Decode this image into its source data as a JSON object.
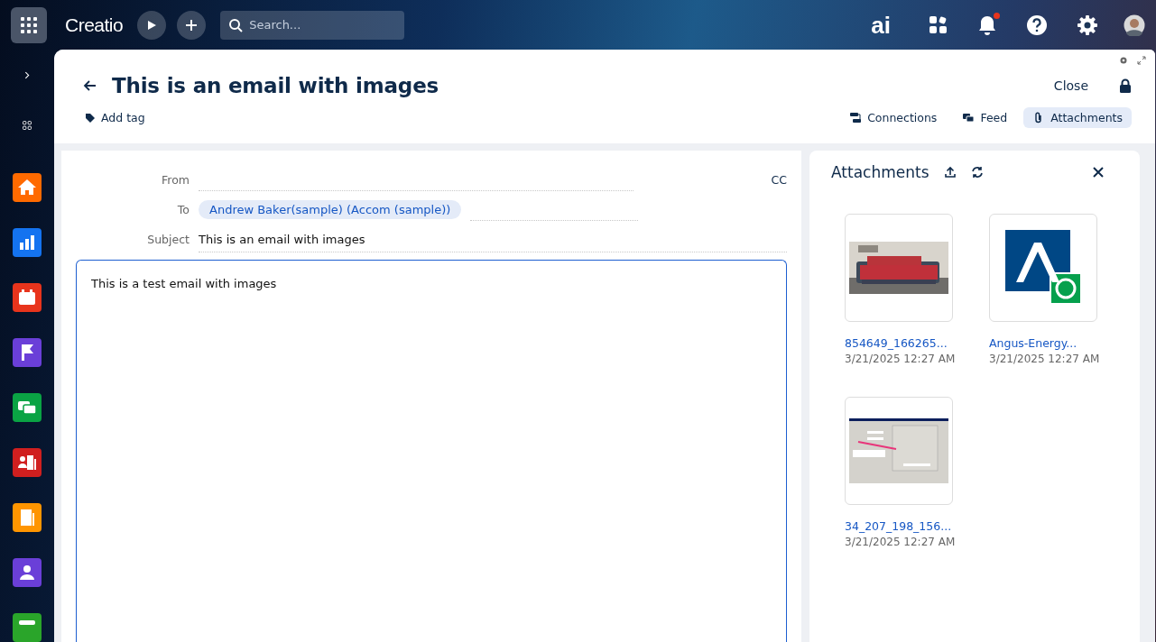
{
  "topbar": {
    "logo": "Creatio",
    "search": {
      "placeholder": "Search..."
    },
    "ai_label": "ai",
    "notifications_unread": true
  },
  "sidebar": {
    "apps": [
      {
        "kind": "home",
        "color": "#ff6a00"
      },
      {
        "kind": "chart",
        "color": "#1473f0"
      },
      {
        "kind": "calendar",
        "color": "#e8341c"
      },
      {
        "kind": "flag",
        "color": "#6a3fd8"
      },
      {
        "kind": "chat",
        "color": "#0aa344"
      },
      {
        "kind": "contacts",
        "color": "#d01f1f"
      },
      {
        "kind": "building",
        "color": "#ff9500"
      },
      {
        "kind": "person",
        "color": "#6a3fd8"
      },
      {
        "kind": "inbox",
        "color": "#2aa52a"
      }
    ]
  },
  "page": {
    "title": "This is an email with images",
    "add_tag": "Add tag",
    "close": "Close",
    "tabs": [
      {
        "label": "Connections",
        "kind": "connections",
        "selected": false
      },
      {
        "label": "Feed",
        "kind": "feed",
        "selected": false
      },
      {
        "label": "Attachments",
        "kind": "attachments",
        "selected": true
      }
    ]
  },
  "email": {
    "from_label": "From",
    "cc_label": "CC",
    "to_label": "To",
    "recipients": [
      "Andrew Baker(sample) (Accom (sample))"
    ],
    "subject_label": "Subject",
    "subject": "This is an email with images",
    "body": "This is a test email with images"
  },
  "attachments": {
    "title": "Attachments",
    "files": [
      {
        "name": "854649_166265...",
        "date": "3/21/2025 12:27 AM"
      },
      {
        "name": "Angus-Energy...",
        "date": "3/21/2025 12:27 AM",
        "kind": "logo"
      },
      {
        "name": "34_207_198_156...",
        "date": "3/21/2025 12:27 AM",
        "kind": "screenshot"
      }
    ]
  }
}
